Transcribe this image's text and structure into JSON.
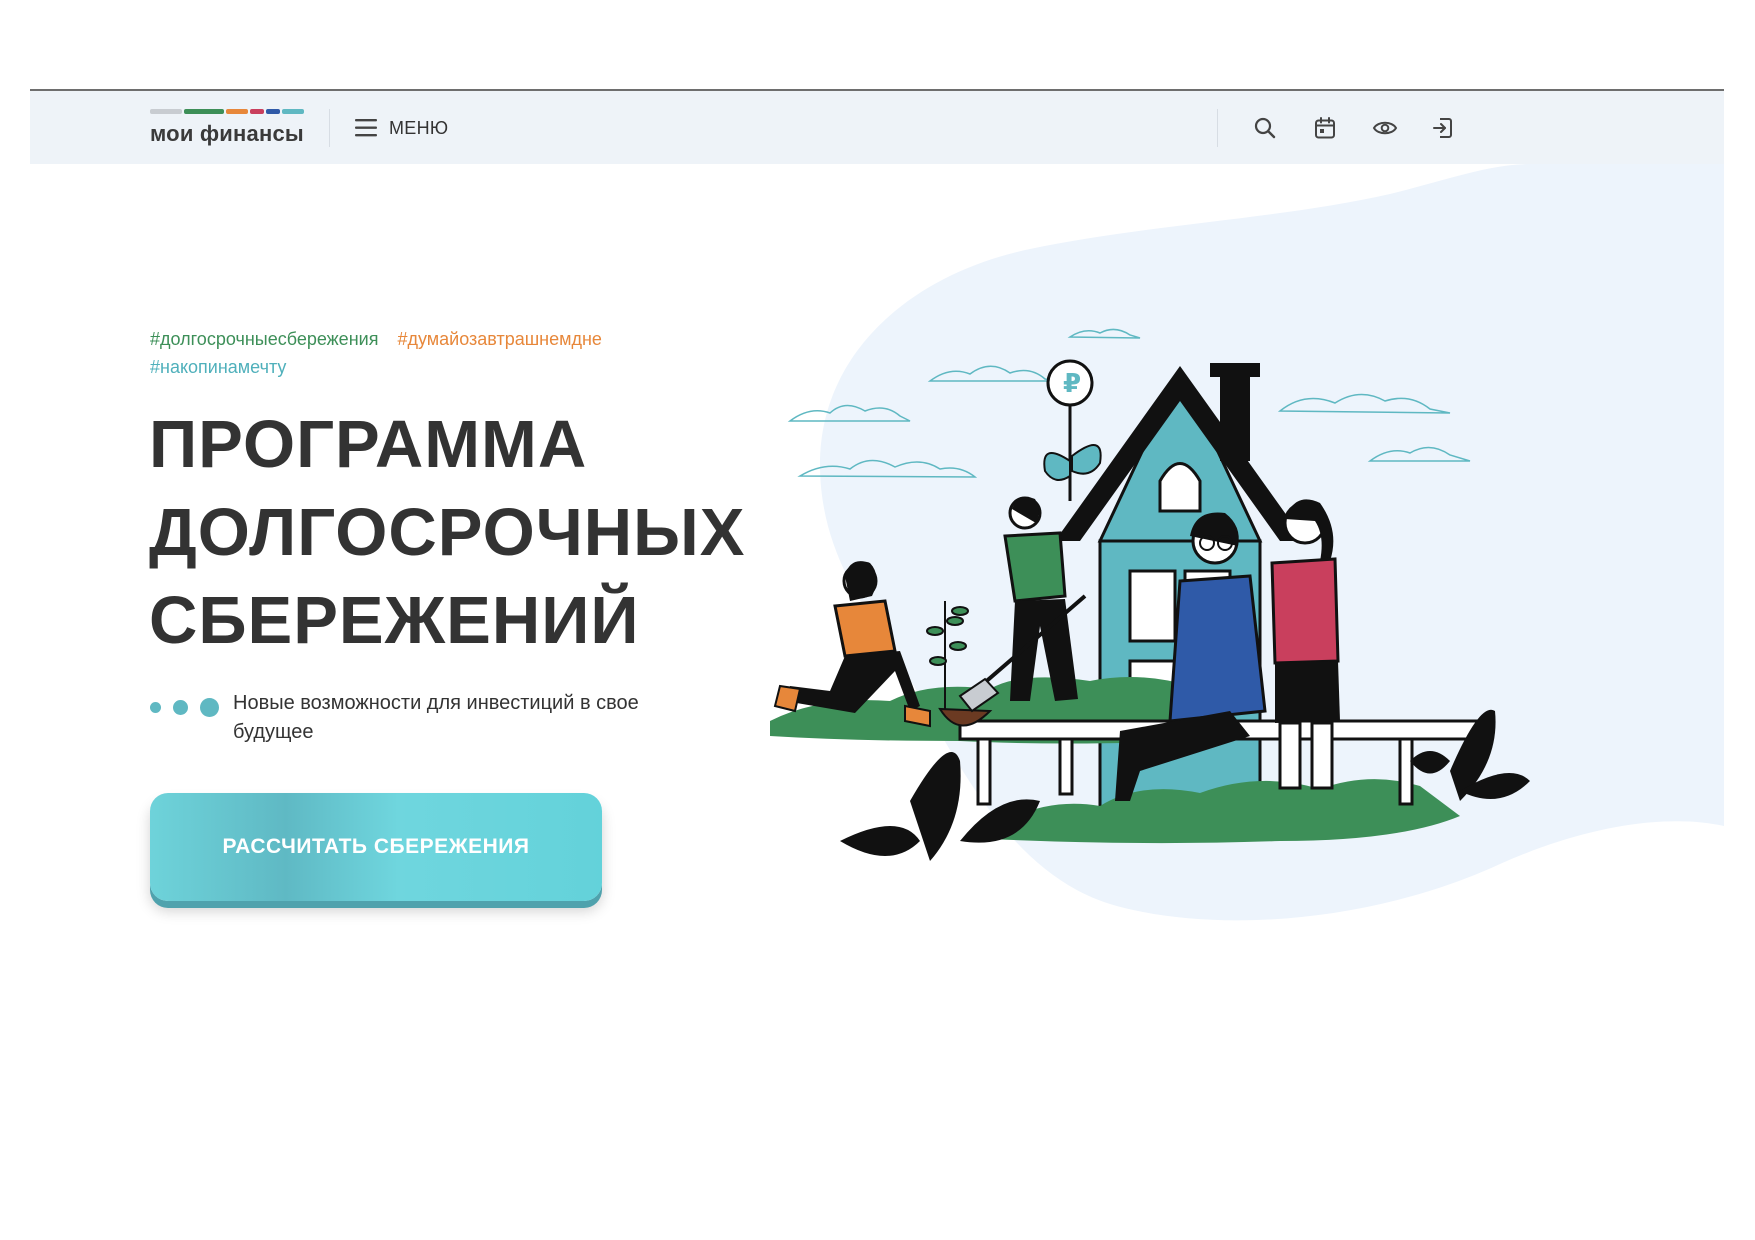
{
  "header": {
    "logo": {
      "text": "мои финансы",
      "bar_colors": [
        "#c8ccd1",
        "#3d8f58",
        "#e7873a",
        "#c93f5d",
        "#2f5aa8",
        "#5fb8c2"
      ]
    },
    "menu_label": "МЕНЮ",
    "icons": [
      "search-icon",
      "calendar-icon",
      "eye-icon",
      "login-icon"
    ]
  },
  "hero": {
    "hashtags": [
      {
        "text": "#долгосрочныесбережения",
        "color": "#3d8f58"
      },
      {
        "text": "#думайозавтрашнемдне",
        "color": "#e7873a"
      },
      {
        "text": "#накопинамечту",
        "color": "#4fb0bb"
      }
    ],
    "title_lines": [
      "ПРОГРАММА",
      "ДОЛГОСРОЧНЫХ",
      "СБЕРЕЖЕНИЙ"
    ],
    "subtitle": "Новые возможности для инвестиций в свое будущее",
    "cta_label": "РАССЧИТАТЬ СБЕРЕЖЕНИЯ"
  },
  "colors": {
    "accent": "#5fb8c2",
    "header_bg": "#eef3f8",
    "blob": "#edf4fc",
    "green": "#3d8f58",
    "orange": "#e7873a",
    "pink": "#c93f5d",
    "blue": "#2f5aa8"
  }
}
